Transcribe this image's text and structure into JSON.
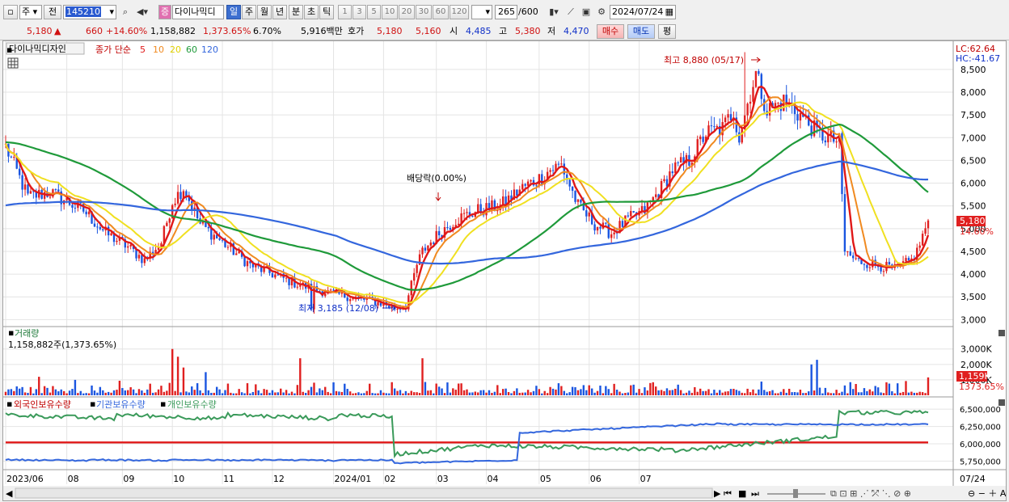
{
  "toolbar": {
    "market_select": "주",
    "prev_label": "전",
    "stock_code": "145210",
    "stock_name": "다이나믹디",
    "zeung_badge": "증",
    "period_buttons": [
      "일",
      "주",
      "월",
      "년",
      "분",
      "초",
      "틱"
    ],
    "interval_buttons": [
      "1",
      "3",
      "5",
      "10",
      "20",
      "30",
      "60",
      "120"
    ],
    "count_value": "265",
    "count_total": "/600",
    "date_value": "2024/07/24"
  },
  "quote": {
    "price": "5,180",
    "change": "660",
    "change_pct": "+14.60%",
    "volume": "1,158,882",
    "volume_ratio": "1,373.65%",
    "turnover": "6.70%",
    "amount": "5,916백만",
    "bid_label": "호가",
    "ask_price": "5,180",
    "bid_price": "5,160",
    "open_label": "시",
    "open": "4,485",
    "high_label": "고",
    "high": "5,380",
    "low_label": "저",
    "low": "4,470",
    "buy_button": "매수",
    "sell_button": "매도",
    "eval_button": "평"
  },
  "colors": {
    "up": "#e02020",
    "down": "#1a55e0",
    "ma5": "#e01818",
    "ma10": "#f08a20",
    "ma20": "#f0e020",
    "ma60": "#1f9a3a",
    "ma120": "#3366dd",
    "foreign": "#3366dd",
    "institution": "#e01818",
    "individual": "#3a9a5a"
  },
  "price_panel": {
    "title": "다이나믹디자인",
    "legend_prefix": "종가 단순",
    "ma_periods": [
      "5",
      "10",
      "20",
      "60",
      "120"
    ],
    "lc": "LC:62.64",
    "hc": "HC:-41.67",
    "max_annotation": "최고 8,880 (05/17)",
    "min_annotation": "최저 3,185 (12/08)",
    "dividend_annotation": "배당락(0.00%)",
    "last_price_tag": "5,180",
    "last_change_tag": "14.60%"
  },
  "volume_panel": {
    "title": "거래량",
    "subtitle": "1,158,882주(1,373.65%)",
    "last_tag": "1,159K",
    "last_ratio_tag": "1373.65%"
  },
  "holding_panel": {
    "legend": [
      "외국인보유수량",
      "기관보유수량",
      "개인보유수량"
    ]
  },
  "nav": {
    "last_date": "07/24"
  },
  "chart_data": [
    {
      "type": "candlestick",
      "title": "다이나믹디자인",
      "y_ticks": [
        3000,
        3500,
        4000,
        4500,
        5000,
        5500,
        6000,
        6500,
        7000,
        7500,
        8000,
        8500
      ],
      "ylim": [
        2900,
        8800
      ],
      "x_tick_labels": [
        "2023/06",
        "08",
        "09",
        "10",
        "11",
        "12",
        "2024/01",
        "02",
        "03",
        "04",
        "05",
        "06",
        "07"
      ],
      "max_price": 8880,
      "min_price": 3185,
      "last_close": 5180,
      "approx_close_path": [
        [
          0,
          6800
        ],
        [
          8,
          5700
        ],
        [
          16,
          5800
        ],
        [
          22,
          5600
        ],
        [
          28,
          5400
        ],
        [
          36,
          4900
        ],
        [
          44,
          4600
        ],
        [
          50,
          4300
        ],
        [
          56,
          4700
        ],
        [
          60,
          5600
        ],
        [
          64,
          5900
        ],
        [
          70,
          5100
        ],
        [
          76,
          4800
        ],
        [
          82,
          4500
        ],
        [
          88,
          4200
        ],
        [
          96,
          4000
        ],
        [
          104,
          3800
        ],
        [
          112,
          3650
        ],
        [
          120,
          3550
        ],
        [
          128,
          3450
        ],
        [
          136,
          3350
        ],
        [
          140,
          3250
        ],
        [
          144,
          3300
        ],
        [
          148,
          4200
        ],
        [
          150,
          4500
        ],
        [
          156,
          4900
        ],
        [
          162,
          5200
        ],
        [
          170,
          5400
        ],
        [
          178,
          5500
        ],
        [
          186,
          5900
        ],
        [
          192,
          6100
        ],
        [
          196,
          6300
        ],
        [
          200,
          6400
        ],
        [
          206,
          5500
        ],
        [
          212,
          5100
        ],
        [
          218,
          4900
        ],
        [
          224,
          5200
        ],
        [
          230,
          5400
        ],
        [
          236,
          5900
        ],
        [
          240,
          6300
        ],
        [
          246,
          6500
        ],
        [
          252,
          7100
        ],
        [
          258,
          7200
        ],
        [
          262,
          7600
        ],
        [
          264,
          7000
        ],
        [
          268,
          8000
        ],
        [
          270,
          8400
        ],
        [
          274,
          7600
        ],
        [
          280,
          7800
        ],
        [
          286,
          7500
        ],
        [
          292,
          7100
        ],
        [
          296,
          7000
        ],
        [
          300,
          6900
        ],
        [
          302,
          4500
        ],
        [
          306,
          4300
        ],
        [
          314,
          4200
        ],
        [
          320,
          4100
        ],
        [
          326,
          4300
        ],
        [
          328,
          4500
        ],
        [
          332,
          5180
        ]
      ]
    },
    {
      "type": "bar",
      "title": "거래량",
      "y_ticks": [
        "3,000K",
        "2,000K",
        "1,000K"
      ],
      "last_volume": 1158882,
      "unit": "주"
    },
    {
      "type": "line",
      "series": [
        {
          "name": "외국인보유수량"
        },
        {
          "name": "기관보유수량"
        },
        {
          "name": "개인보유수량"
        }
      ],
      "y_ticks": [
        "6,500,000",
        "6,250,000",
        "6,000,000",
        "5,750,000"
      ]
    }
  ]
}
